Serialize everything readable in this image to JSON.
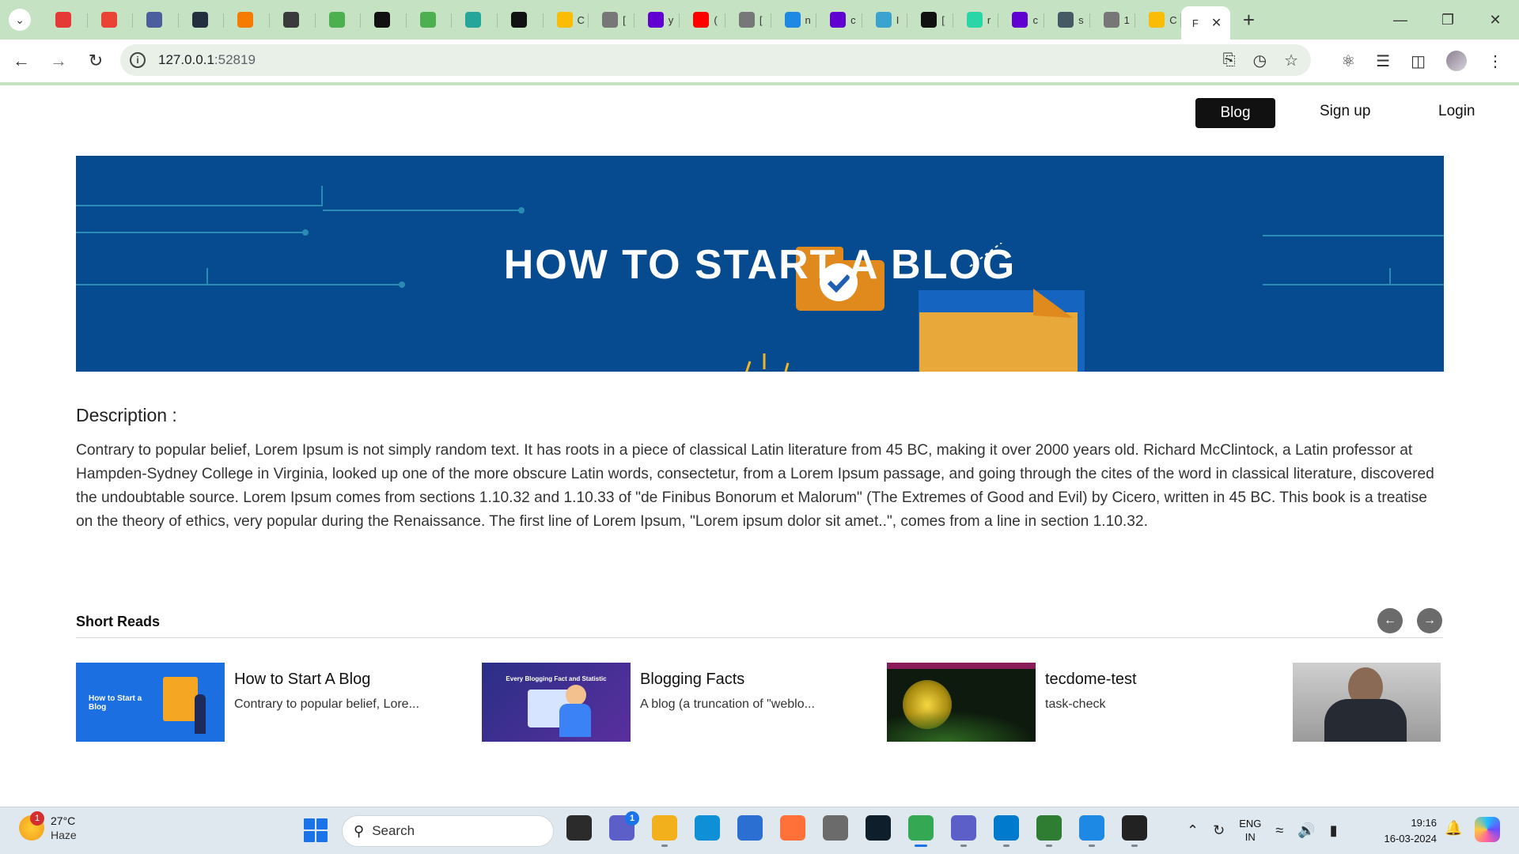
{
  "browser": {
    "tabs": [
      {
        "icon": "chrome-icon",
        "title": "",
        "color": "#e53935"
      },
      {
        "icon": "gmail-icon",
        "title": "",
        "color": "#ea4335"
      },
      {
        "icon": "calculator-icon",
        "title": "",
        "color": "#4b5e9e"
      },
      {
        "icon": "aws-icon",
        "title": "",
        "color": "#232f3e"
      },
      {
        "icon": "cube-icon",
        "title": "",
        "color": "#f57c00"
      },
      {
        "icon": "nx-icon",
        "title": "",
        "color": "#3a3a3a"
      },
      {
        "icon": "link-icon",
        "title": "",
        "color": "#4caf50"
      },
      {
        "icon": "q-icon",
        "title": "",
        "color": "#111111"
      },
      {
        "icon": "link-icon",
        "title": "",
        "color": "#4caf50"
      },
      {
        "icon": "n-icon",
        "title": "",
        "color": "#26a69a"
      },
      {
        "icon": "r-icon",
        "title": "",
        "color": "#111111"
      },
      {
        "icon": "photos-icon",
        "title": "C",
        "color": "#fbbc05"
      },
      {
        "icon": "globe-icon",
        "title": "[",
        "color": "#777777"
      },
      {
        "icon": "yahoo-icon",
        "title": "y",
        "color": "#6001d2"
      },
      {
        "icon": "youtube-icon",
        "title": "(",
        "color": "#ff0000"
      },
      {
        "icon": "globe-icon",
        "title": "[",
        "color": "#777777"
      },
      {
        "icon": "globe-icon",
        "title": "n",
        "color": "#1e88e5"
      },
      {
        "icon": "yahoo-icon",
        "title": "c",
        "color": "#6001d2"
      },
      {
        "icon": "globe-icon",
        "title": "I",
        "color": "#3ba3d0"
      },
      {
        "icon": "circle-icon",
        "title": "[",
        "color": "#111111"
      },
      {
        "icon": "snowflake-icon",
        "title": "r",
        "color": "#2bd6a6"
      },
      {
        "icon": "yahoo-icon",
        "title": "c",
        "color": "#6001d2"
      },
      {
        "icon": "globe-icon",
        "title": "s",
        "color": "#455a64"
      },
      {
        "icon": "globe-icon",
        "title": "1",
        "color": "#777777"
      },
      {
        "icon": "photos-icon",
        "title": "C",
        "color": "#fbbc05"
      }
    ],
    "active_tab": {
      "title": "F"
    },
    "url_host": "127.0.0.1",
    "url_port": ":52819"
  },
  "site": {
    "nav": {
      "blog": "Blog",
      "signup": "Sign up",
      "login": "Login"
    },
    "hero_title": "HOW TO START A BLOG",
    "description_heading": "Description :",
    "description_text": "Contrary to popular belief, Lorem Ipsum is not simply random text. It has roots in a piece of classical Latin literature from 45 BC, making it over 2000 years old. Richard McClintock, a Latin professor at Hampden-Sydney College in Virginia, looked up one of the more obscure Latin words, consectetur, from a Lorem Ipsum passage, and going through the cites of the word in classical literature, discovered the undoubtable source. Lorem Ipsum comes from sections 1.10.32 and 1.10.33 of \"de Finibus Bonorum et Malorum\" (The Extremes of Good and Evil) by Cicero, written in 45 BC. This book is a treatise on the theory of ethics, very popular during the Renaissance. The first line of Lorem Ipsum, \"Lorem ipsum dolor sit amet..\", comes from a line in section 1.10.32.",
    "short_reads_title": "Short Reads",
    "cards": [
      {
        "title": "How to Start A Blog",
        "excerpt": "Contrary to popular belief, Lore...",
        "thumb_text": "How to Start a Blog"
      },
      {
        "title": "Blogging Facts",
        "excerpt": "A blog (a truncation of \"weblo...",
        "thumb_text": "Every Blogging Fact and Statistic"
      },
      {
        "title": "tecdome-test",
        "excerpt": "task-check",
        "thumb_text": ""
      },
      {
        "title": "",
        "excerpt": "",
        "thumb_text": ""
      }
    ]
  },
  "taskbar": {
    "weather_temp": "27°C",
    "weather_cond": "Haze",
    "weather_badge": "1",
    "search_placeholder": "Search",
    "apps": [
      {
        "icon": "task-view-icon",
        "color": "#2b2b2b"
      },
      {
        "icon": "chat-icon",
        "color": "#5b5fc7",
        "badge": "1"
      },
      {
        "icon": "file-explorer-icon",
        "color": "#f2b11c"
      },
      {
        "icon": "edge-icon",
        "color": "#0f8fd6"
      },
      {
        "icon": "store-icon",
        "color": "#2a6fd1"
      },
      {
        "icon": "firefox-icon",
        "color": "#ff7139"
      },
      {
        "icon": "amazon-icon",
        "color": "#6b6b6b"
      },
      {
        "icon": "dropbox-icon",
        "color": "#0f1e2b"
      },
      {
        "icon": "chrome-icon",
        "color": "#34a853"
      },
      {
        "icon": "teams-icon",
        "color": "#5b5fc7"
      },
      {
        "icon": "vscode-icon",
        "color": "#007acc"
      },
      {
        "icon": "chrome-dev-icon",
        "color": "#2e7d32"
      },
      {
        "icon": "cloud-icon",
        "color": "#1e88e5"
      },
      {
        "icon": "terminal-icon",
        "color": "#222222"
      }
    ],
    "lang_1": "ENG",
    "lang_2": "IN",
    "time": "19:16",
    "date": "16-03-2024"
  }
}
